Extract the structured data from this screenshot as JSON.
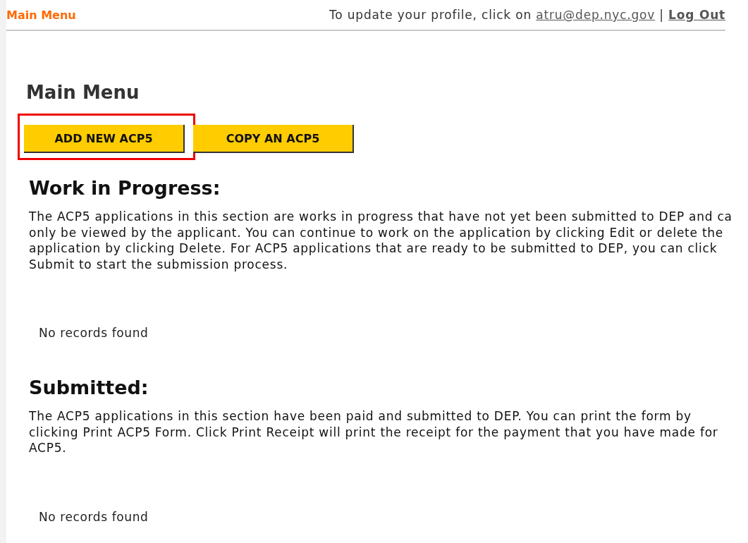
{
  "header": {
    "title": "Main Menu",
    "profile_text": "To update your profile, click on",
    "email": "atru@dep.nyc.gov",
    "separator": "|",
    "logout": "Log Out"
  },
  "page_title": "Main Menu",
  "buttons": [
    {
      "label": "ADD NEW ACP5",
      "highlighted": true
    },
    {
      "label": "COPY AN ACP5",
      "highlighted": false
    }
  ],
  "sections": [
    {
      "title": "Work in Progress:",
      "description": [
        "The ACP5 applications in this section are works in progress that have not yet been submitted to DEP and ca",
        "only be viewed by the applicant. You can continue to work on the application by clicking Edit or delete the",
        "application by clicking Delete. For ACP5 applications that are ready to be submitted to DEP, you can click",
        "Submit to start the submission process."
      ],
      "empty_message": "No records found"
    },
    {
      "title": "Submitted:",
      "description": [
        "The ACP5 applications in this section have been paid and submitted to DEP. You can print the form by",
        "clicking Print ACP5 Form. Click Print Receipt will print the receipt for the payment that you have made for",
        "ACP5."
      ],
      "empty_message": "No records found"
    }
  ]
}
